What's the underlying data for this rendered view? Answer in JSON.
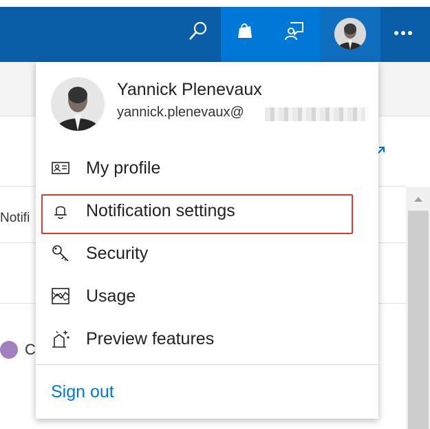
{
  "header": {
    "search_icon": "search-icon",
    "marketplace_icon": "shopping-bag-icon",
    "feedback_icon": "feedback-icon",
    "avatar_icon": "user-avatar",
    "more_icon": "more-dots-icon"
  },
  "background": {
    "partial_tab_text": "Notifi",
    "partial_item_text": "C"
  },
  "profile": {
    "name": "Yannick Plenevaux",
    "email": "yannick.plenevaux@"
  },
  "menu": {
    "items": [
      {
        "label": "My profile",
        "icon": "contact-card-icon"
      },
      {
        "label": "Notification settings",
        "icon": "bell-icon"
      },
      {
        "label": "Security",
        "icon": "key-icon"
      },
      {
        "label": "Usage",
        "icon": "usage-chart-icon"
      },
      {
        "label": "Preview features",
        "icon": "preview-sparkle-icon"
      }
    ],
    "sign_out": "Sign out"
  },
  "colors": {
    "header_dark": "#0a5ea8",
    "header_light": "#0078d7",
    "highlight": "#d83a3a",
    "link": "#0078d7"
  }
}
